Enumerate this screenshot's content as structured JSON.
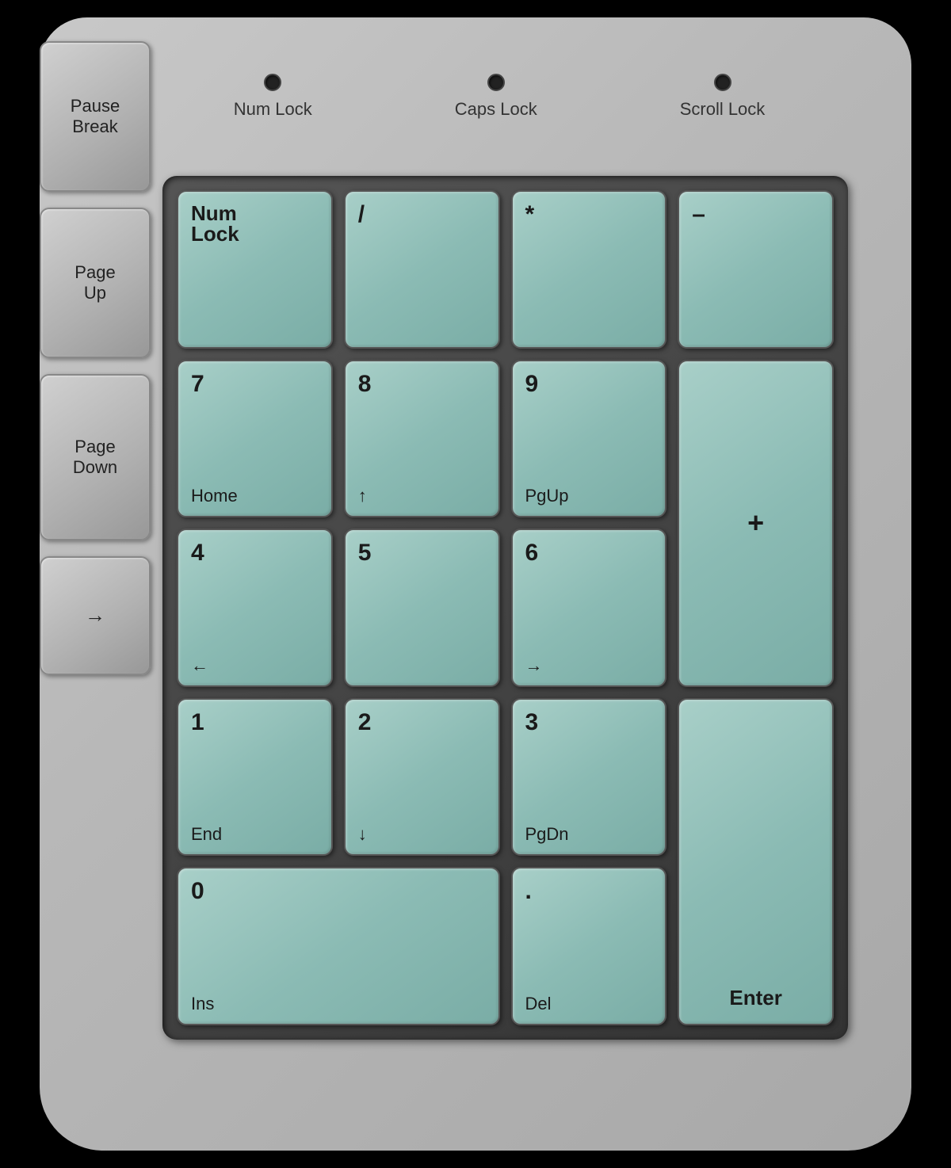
{
  "keyboard": {
    "background_color": "#b8b8b8",
    "indicators": [
      {
        "id": "num-lock",
        "label": "Num Lock"
      },
      {
        "id": "caps-lock",
        "label": "Caps Lock"
      },
      {
        "id": "scroll-lock",
        "label": "Scroll Lock"
      }
    ],
    "side_keys": [
      {
        "id": "pause-break",
        "label": "Pause\nBreak"
      },
      {
        "id": "page-up",
        "label": "Page\nUp"
      },
      {
        "id": "page-down",
        "label": "Page\nDown"
      },
      {
        "id": "arrow-right",
        "label": "→"
      }
    ],
    "numpad_keys": [
      {
        "id": "num-lock-key",
        "main": "Num",
        "main2": "Lock",
        "sub": "",
        "class": "key-numlock"
      },
      {
        "id": "slash-key",
        "main": "/",
        "sub": "",
        "class": "key-slash"
      },
      {
        "id": "star-key",
        "main": "*",
        "sub": "",
        "class": "key-star"
      },
      {
        "id": "minus-key",
        "main": "–",
        "sub": "",
        "class": "key-minus"
      },
      {
        "id": "7-key",
        "main": "7",
        "sub": "Home",
        "class": "key-7"
      },
      {
        "id": "8-key",
        "main": "8",
        "sub": "↑",
        "class": "key-8"
      },
      {
        "id": "9-key",
        "main": "9",
        "sub": "PgUp",
        "class": "key-9"
      },
      {
        "id": "plus-key",
        "main": "+",
        "sub": "",
        "class": "key-plus"
      },
      {
        "id": "4-key",
        "main": "4",
        "sub": "←",
        "class": "key-4"
      },
      {
        "id": "5-key",
        "main": "5",
        "sub": "",
        "class": "key-5"
      },
      {
        "id": "6-key",
        "main": "6",
        "sub": "→",
        "class": "key-6"
      },
      {
        "id": "1-key",
        "main": "1",
        "sub": "End",
        "class": "key-1"
      },
      {
        "id": "2-key",
        "main": "2",
        "sub": "↓",
        "class": "key-2"
      },
      {
        "id": "3-key",
        "main": "3",
        "sub": "PgDn",
        "class": "key-3"
      },
      {
        "id": "enter-key",
        "main": "Enter",
        "sub": "",
        "class": "key-enter"
      },
      {
        "id": "0-key",
        "main": "0",
        "sub": "Ins",
        "class": "key-0"
      },
      {
        "id": "dot-key",
        "main": ".",
        "sub": "Del",
        "class": "key-dot"
      }
    ]
  }
}
